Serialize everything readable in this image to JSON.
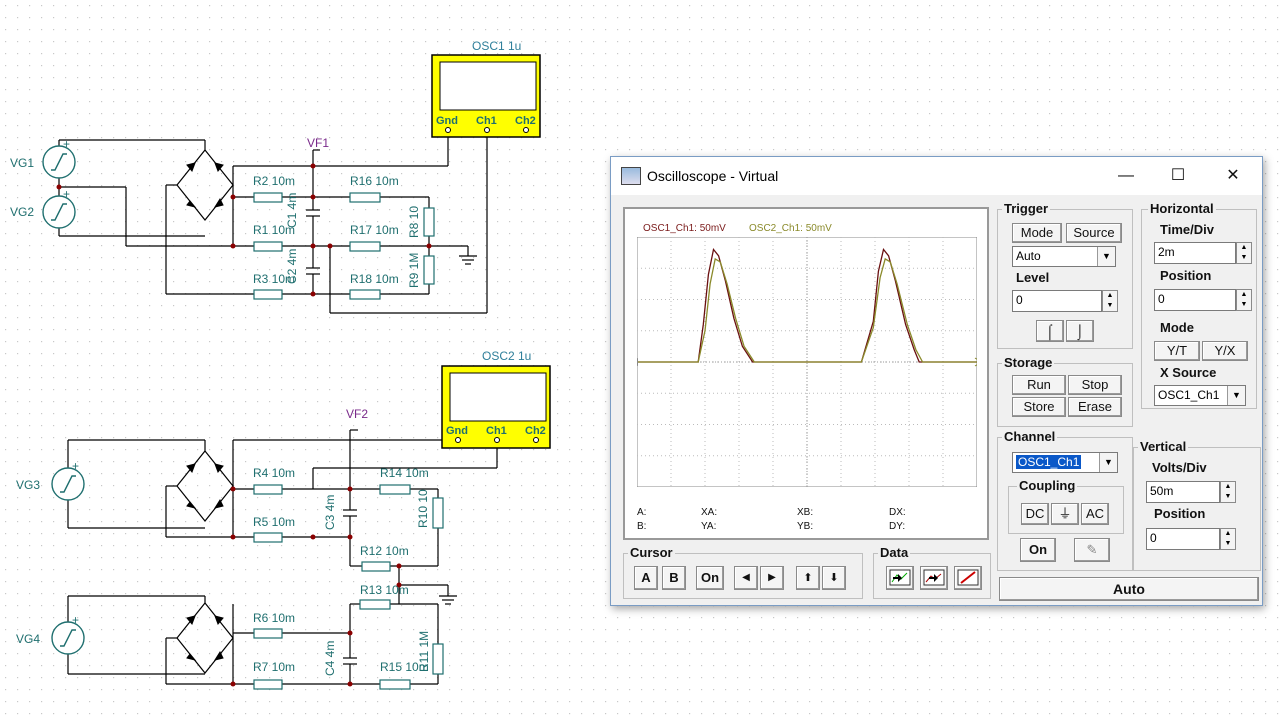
{
  "schematic": {
    "labels": {
      "vg1": "VG1",
      "vg2": "VG2",
      "vg3": "VG3",
      "vg4": "VG4",
      "vf1": "VF1",
      "vf2": "VF2",
      "osc1": "OSC1 1u",
      "osc2": "OSC2 1u",
      "r2": "R2 10m",
      "r1": "R1 10m",
      "r3": "R3 10m",
      "r16": "R16 10m",
      "r17": "R17 10m",
      "r18": "R18 10m",
      "r8": "R8 10",
      "r9": "R9 1M",
      "c1": "C1 4m",
      "c2": "C2 4m",
      "r4": "R4 10m",
      "r5": "R5 10m",
      "r14": "R14 10m",
      "r10": "R10 10",
      "c3": "C3 4m",
      "r12": "R12 10m",
      "r13": "R13 10m",
      "r6": "R6 10m",
      "r7": "R7 10m",
      "c4": "C4 4m",
      "r15": "R15 10m",
      "r11": "R11 1M"
    },
    "pins": {
      "gnd": "Gnd",
      "ch1": "Ch1",
      "ch2": "Ch2"
    }
  },
  "window": {
    "title": "Oscilloscope - Virtual",
    "controls": {
      "minimize": "—",
      "maximize": "☐",
      "close": "✕"
    },
    "screen": {
      "legend1": "OSC1_Ch1: 50mV",
      "legend2": "OSC2_Ch1: 50mV",
      "legend1_color": "#7a1a1a",
      "legend2_color": "#8a8a2a",
      "readout": {
        "a": "A:",
        "b": "B:",
        "xa": "XA:",
        "ya": "YA:",
        "xb": "XB:",
        "yb": "YB:",
        "dx": "DX:",
        "dy": "DY:"
      }
    },
    "trigger": {
      "title": "Trigger",
      "mode_btn": "Mode",
      "source_btn": "Source",
      "mode_value": "Auto",
      "level_label": "Level",
      "level_value": "0"
    },
    "horizontal": {
      "title": "Horizontal",
      "time_div_label": "Time/Div",
      "time_div_value": "2m",
      "position_label": "Position",
      "position_value": "0",
      "mode_label": "Mode",
      "mode_yt": "Y/T",
      "mode_yx": "Y/X",
      "xsource_label": "X Source",
      "xsource_value": "OSC1_Ch1"
    },
    "storage": {
      "title": "Storage",
      "run": "Run",
      "stop": "Stop",
      "store": "Store",
      "erase": "Erase"
    },
    "channel": {
      "title": "Channel",
      "value": "OSC1_Ch1",
      "coupling_label": "Coupling",
      "dc": "DC",
      "gnd": "⏚",
      "ac": "AC",
      "on": "On"
    },
    "vertical": {
      "title": "Vertical",
      "volts_div_label": "Volts/Div",
      "volts_div_value": "50m",
      "position_label": "Position",
      "position_value": "0"
    },
    "cursor": {
      "title": "Cursor",
      "a": "A",
      "b": "B",
      "on": "On",
      "left": "◀",
      "right": "▶",
      "up": "⬆",
      "down": "⬇"
    },
    "data": {
      "title": "Data"
    },
    "auto": "Auto"
  },
  "chart_data": {
    "type": "line",
    "x_units": "div",
    "y_units": "div",
    "xlim": [
      -5,
      5
    ],
    "ylim": [
      -4,
      4
    ],
    "grid": true,
    "series": [
      {
        "name": "OSC1_Ch1: 50mV",
        "color": "#6a1010",
        "x": [
          -5,
          -3.2,
          -3.05,
          -2.9,
          -2.75,
          -2.6,
          -2.4,
          -2.15,
          -1.9,
          -1.6,
          -1.4,
          -0.5,
          1.6,
          1.95,
          2.1,
          2.25,
          2.4,
          2.6,
          2.9,
          3.15,
          3.3,
          3.5,
          5
        ],
        "y": [
          0,
          0,
          1.2,
          2.8,
          3.6,
          3.4,
          2.6,
          1.4,
          0.5,
          0,
          0,
          0,
          0,
          1.3,
          2.9,
          3.6,
          3.4,
          2.6,
          1.2,
          0.4,
          0,
          0,
          0
        ]
      },
      {
        "name": "OSC2_Ch1: 50mV",
        "color": "#8a8a2a",
        "x": [
          -5,
          -3.2,
          -3.0,
          -2.85,
          -2.7,
          -2.55,
          -2.35,
          -2.1,
          -1.85,
          -1.55,
          -1.35,
          -0.5,
          1.6,
          1.95,
          2.15,
          2.3,
          2.45,
          2.65,
          2.95,
          3.2,
          3.4,
          3.6,
          5
        ],
        "y": [
          0,
          0,
          1.0,
          2.5,
          3.3,
          3.2,
          2.5,
          1.4,
          0.5,
          0,
          0,
          0,
          0,
          1.1,
          2.7,
          3.3,
          3.2,
          2.5,
          1.2,
          0.4,
          0,
          0,
          0
        ]
      }
    ]
  }
}
